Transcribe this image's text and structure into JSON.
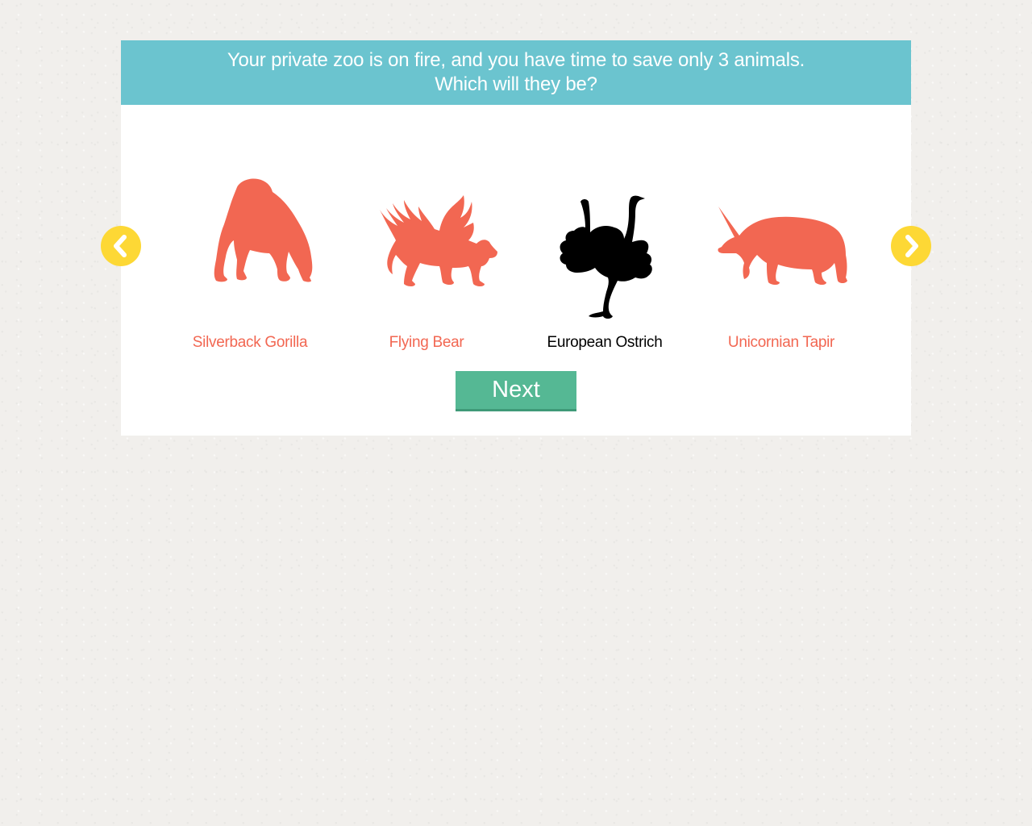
{
  "question": {
    "line1": "Your private zoo is on fire, and you have time to save only 3 animals.",
    "line2": "Which will they be?"
  },
  "animals": [
    {
      "label": "Silverback Gorilla",
      "icon": "gorilla-icon",
      "selected": false
    },
    {
      "label": "Flying Bear",
      "icon": "winged-bear-icon",
      "selected": false
    },
    {
      "label": "European Ostrich",
      "icon": "ostrich-icon",
      "selected": true
    },
    {
      "label": "Unicornian Tapir",
      "icon": "unicorn-tapir-icon",
      "selected": false
    }
  ],
  "navigation": {
    "prev_icon": "chevron-left-icon",
    "next_icon": "chevron-right-icon"
  },
  "next_button": {
    "label": "Next"
  },
  "colors": {
    "header_bg": "#6bc4cf",
    "animal_unselected": "#f26752",
    "animal_selected": "#000000",
    "nav_arrow": "#fdd835",
    "next_button": "#55b894",
    "page_bg": "#f1efec"
  }
}
